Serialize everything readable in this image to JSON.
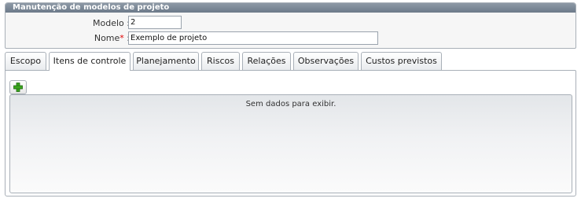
{
  "panel": {
    "title": "Manutenção de modelos de projeto"
  },
  "form": {
    "modelo_label": "Modelo :",
    "modelo_value": "2",
    "nome_label": "Nome",
    "nome_required_mark": "*",
    "nome_colon": " :",
    "nome_value": "Exemplo de projeto"
  },
  "tabs": [
    {
      "label": "Escopo"
    },
    {
      "label": "Itens de controle"
    },
    {
      "label": "Planejamento"
    },
    {
      "label": "Riscos"
    },
    {
      "label": "Relações"
    },
    {
      "label": "Observações"
    },
    {
      "label": "Custos previstos"
    }
  ],
  "active_tab": "Itens de controle",
  "grid": {
    "empty_message": "Sem dados para exibir."
  },
  "toolbar": {
    "add_icon": "plus-icon",
    "add_icon_color": "#3aa51d"
  },
  "colors": {
    "header_bg": "#6c7a89",
    "border": "#a9b0b8",
    "required": "#e00000"
  }
}
